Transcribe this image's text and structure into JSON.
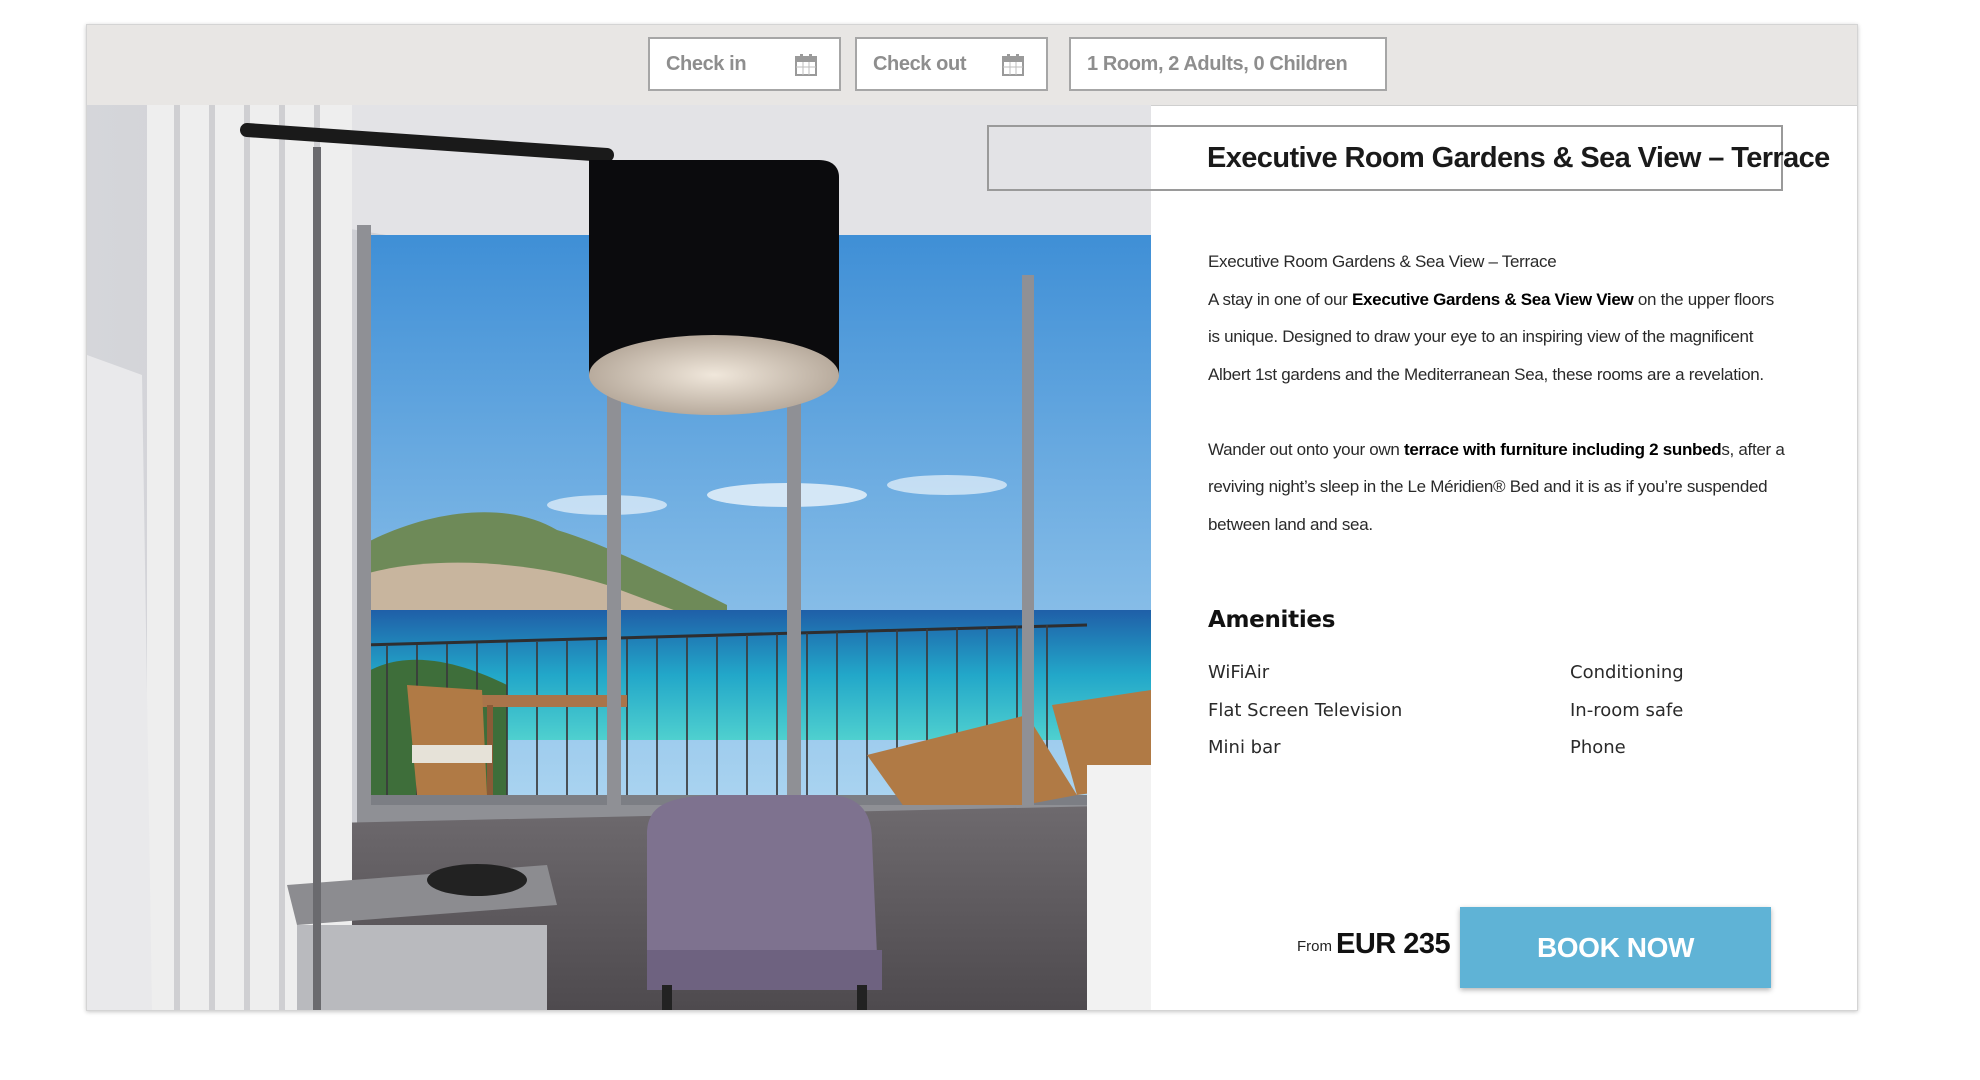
{
  "search": {
    "checkin_placeholder": "Check in",
    "checkout_placeholder": "Check out",
    "guests_value": "1 Room, 2 Adults, 0 Children",
    "calendar_icon": "calendar-icon"
  },
  "room": {
    "title": "Executive Room Gardens & Sea View – Terrace",
    "photo_alt": "hotel-room-photo",
    "desc_heading": "Executive Room Gardens & Sea View – Terrace",
    "p1_pre": "A stay in one of our ",
    "p1_bold": "Executive Gardens & Sea View View",
    "p1_post": " on the upper floors is unique. Designed to draw your eye to an inspiring view of the magnificent Albert 1st gardens and the Mediterranean Sea, these rooms are a revelation.",
    "p2_pre": "Wander out onto your own ",
    "p2_bold": "terrace with furniture including 2 sunbed",
    "p2_post": "s, after a reviving night’s sleep in the Le Méridien® Bed and it is as if you’re suspended between land and sea."
  },
  "amenities": {
    "title": "Amenities",
    "left": [
      "WiFiAir",
      "Flat Screen Television",
      "Mini bar"
    ],
    "right": [
      "Conditioning",
      "In-room safe",
      "Phone"
    ]
  },
  "booking": {
    "from_label": "From",
    "price": "EUR 235",
    "button_label": "BOOK NOW",
    "accent_color": "#5fb3d6"
  }
}
